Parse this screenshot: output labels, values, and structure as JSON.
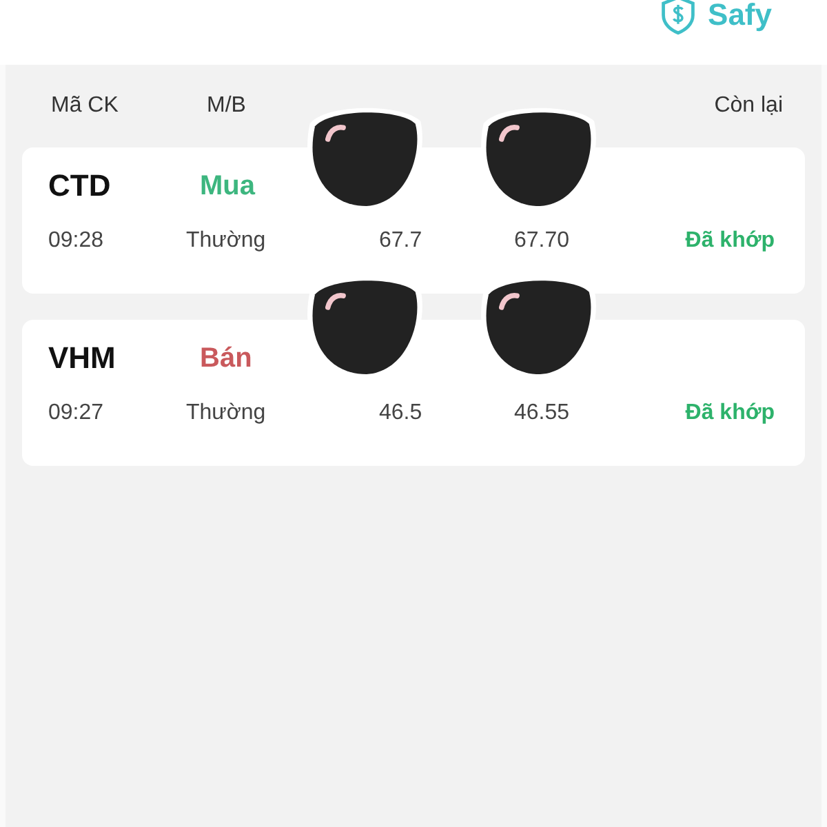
{
  "brand": {
    "name": "Safy"
  },
  "columns": [
    "Mã CK",
    "M/B",
    "Còn lại"
  ],
  "orders": [
    {
      "symbol": "CTD",
      "side": "Mua",
      "color": "#3db67f",
      "time": "09:28",
      "order_type": "Thường",
      "price": "67.7",
      "matched_price": "67.70",
      "status": "Đã khớp"
    },
    {
      "symbol": "VHM",
      "side": "Bán",
      "color": "#c9595c",
      "time": "09:27",
      "order_type": "Thường",
      "price": "46.5",
      "matched_price": "46.55",
      "status": "Đã khớp"
    }
  ]
}
